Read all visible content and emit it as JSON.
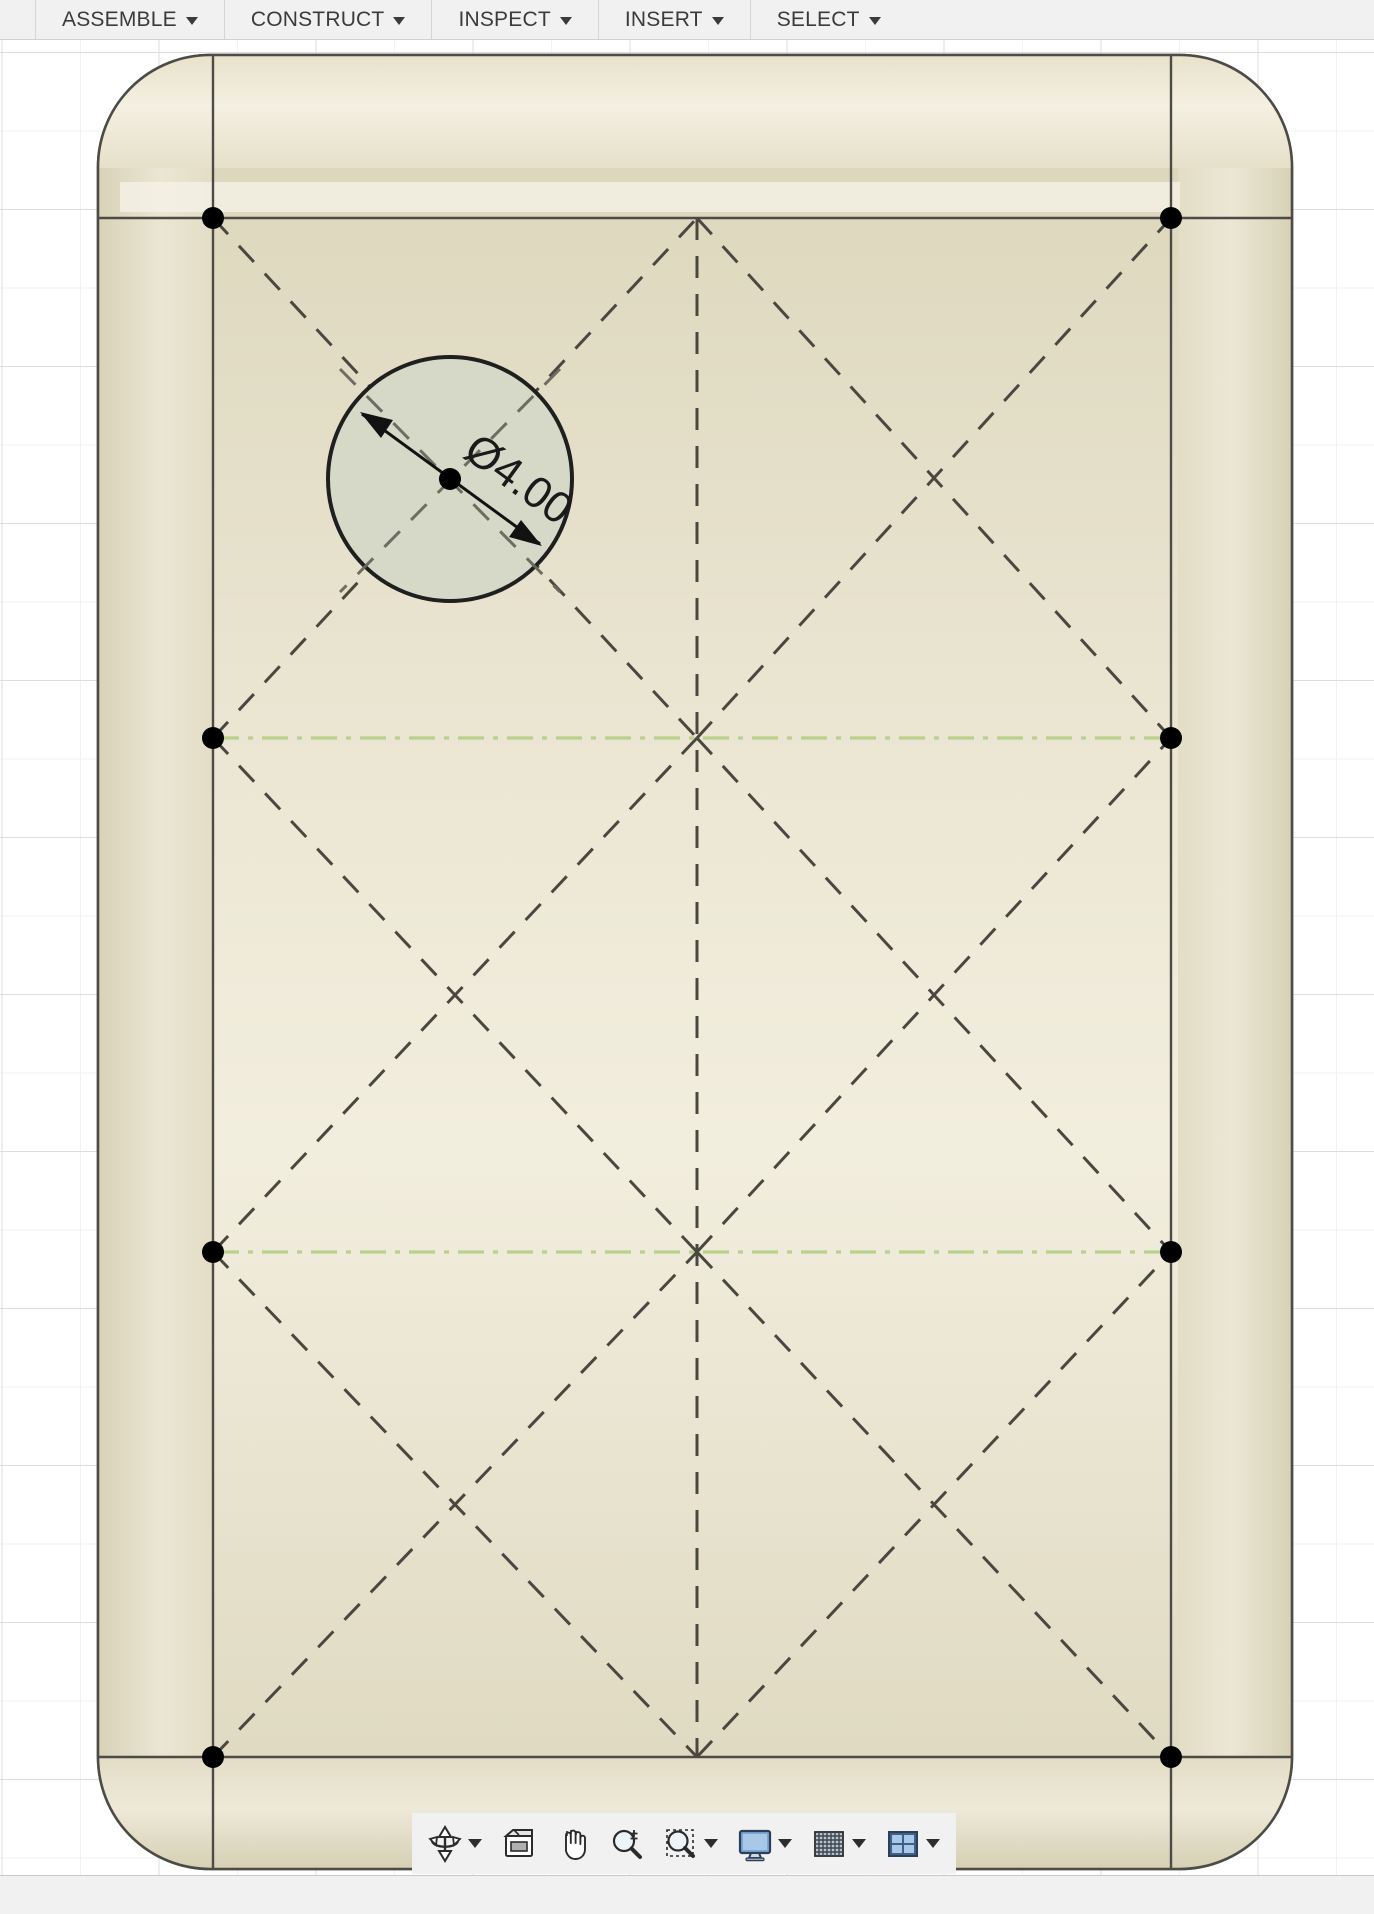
{
  "menu": {
    "items": [
      {
        "label": "ASSEMBLE",
        "icon": "chevron-down-icon",
        "active": false
      },
      {
        "label": "CONSTRUCT",
        "icon": "chevron-down-icon",
        "active": false
      },
      {
        "label": "INSPECT",
        "icon": "chevron-down-icon",
        "active": false
      },
      {
        "label": "INSERT",
        "icon": "chevron-down-icon",
        "active": false
      },
      {
        "label": "SELECT",
        "icon": "chevron-down-icon",
        "active": true
      }
    ],
    "active_accent_color": "#1a8ac4"
  },
  "canvas": {
    "background_color": "#ffffff",
    "grid_minor_color": "#f2f2f2",
    "grid_major_color": "#dddddd",
    "body_fill_color": "#e2dcc4",
    "body_edge_color": "#555550",
    "sketch_line_color": "#4a4740",
    "construction_line_color": "#b9d18a",
    "hole_fill_color": "#d6d9c8",
    "point_color": "#000000"
  },
  "dimension": {
    "label": "Ø4.00",
    "text_color": "#1a1a1a"
  },
  "navbar": {
    "tools": [
      {
        "name": "orbit-icon",
        "label": "Orbit",
        "has_dropdown": true
      },
      {
        "name": "look-at-icon",
        "label": "Look At",
        "has_dropdown": false
      },
      {
        "name": "pan-hand-icon",
        "label": "Pan",
        "has_dropdown": false
      },
      {
        "name": "zoom-magnifier-icon",
        "label": "Zoom",
        "has_dropdown": false
      },
      {
        "name": "zoom-window-icon",
        "label": "Zoom Window",
        "has_dropdown": true
      },
      {
        "name": "display-settings-icon",
        "label": "Display Settings",
        "has_dropdown": true
      },
      {
        "name": "grid-snaps-icon",
        "label": "Grid and Snaps",
        "has_dropdown": true
      },
      {
        "name": "viewports-icon",
        "label": "Viewports",
        "has_dropdown": true
      }
    ]
  }
}
